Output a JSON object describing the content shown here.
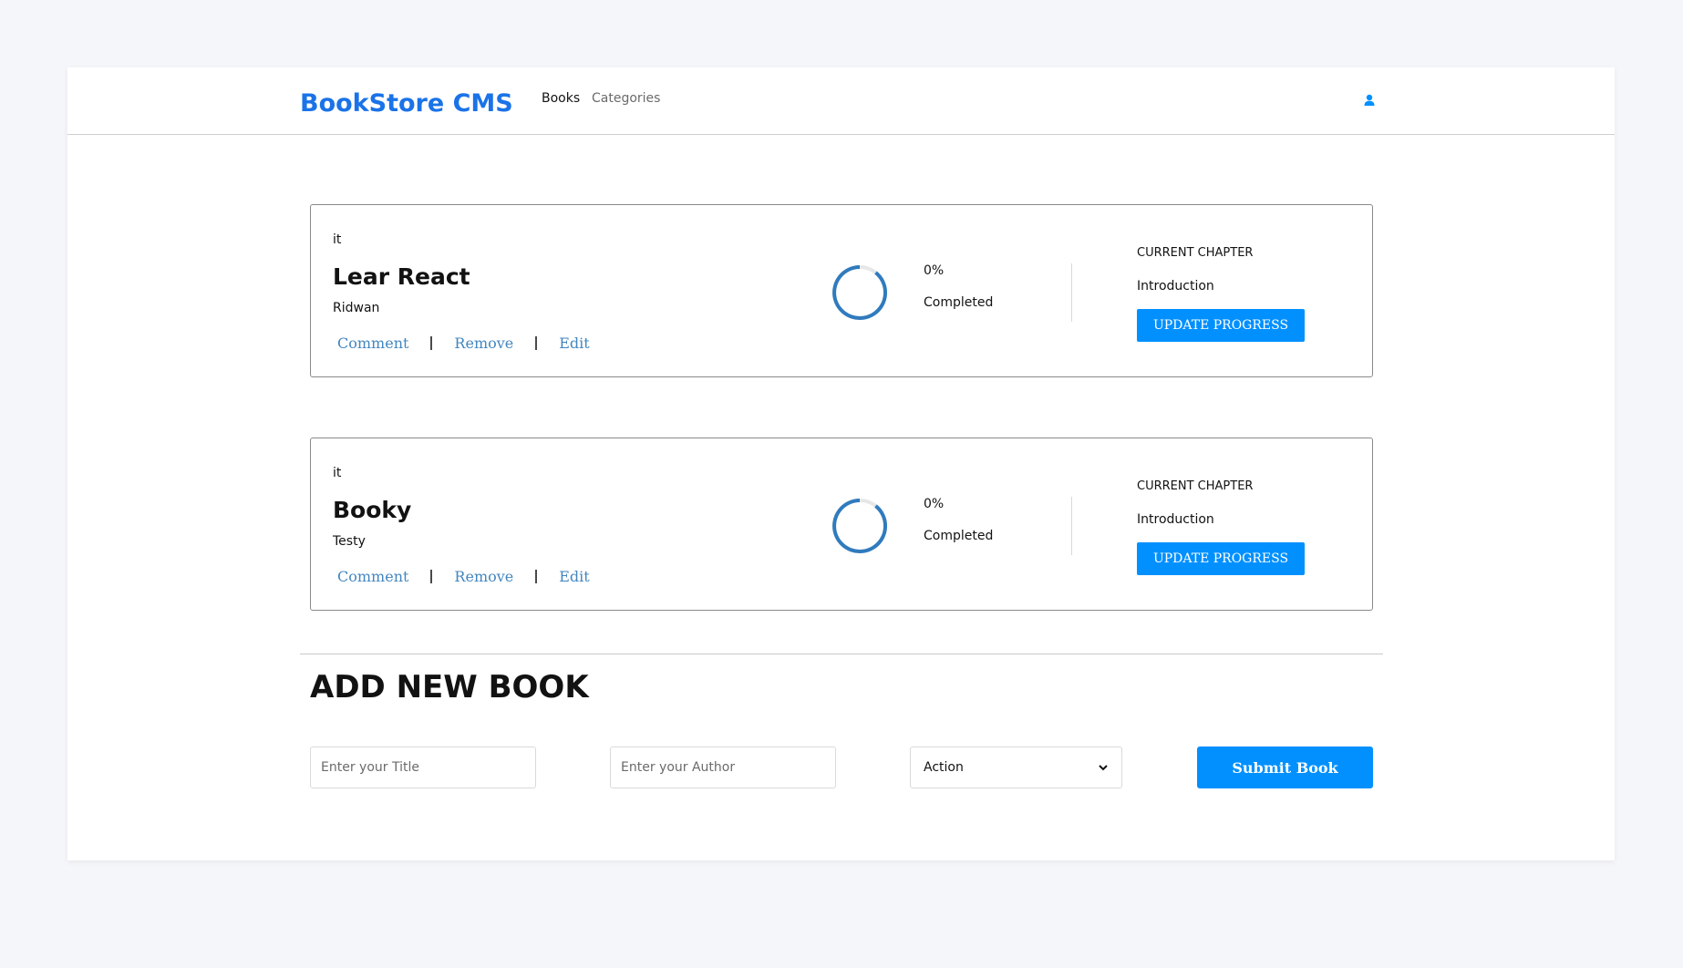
{
  "header": {
    "brand": "BookStore CMS",
    "nav": [
      {
        "label": "Books"
      },
      {
        "label": "Categories"
      }
    ],
    "user_icon": "user-icon"
  },
  "books": [
    {
      "genre": "it",
      "title": "Lear React",
      "author": "Ridwan",
      "actions": {
        "comment": "Comment",
        "remove": "Remove",
        "edit": "Edit"
      },
      "progress": {
        "percent_text": "0%",
        "value": 0,
        "status": "Completed"
      },
      "chapter": {
        "label": "CURRENT CHAPTER",
        "name": "Introduction"
      },
      "update_label": "UPDATE PROGRESS"
    },
    {
      "genre": "it",
      "title": "Booky",
      "author": "Testy",
      "actions": {
        "comment": "Comment",
        "remove": "Remove",
        "edit": "Edit"
      },
      "progress": {
        "percent_text": "0%",
        "value": 0,
        "status": "Completed"
      },
      "chapter": {
        "label": "CURRENT CHAPTER",
        "name": "Introduction"
      },
      "update_label": "UPDATE PROGRESS"
    }
  ],
  "add_book": {
    "heading": "ADD NEW BOOK",
    "title_placeholder": "Enter your Title",
    "author_placeholder": "Enter your Author",
    "category_selected": "Action",
    "submit_label": "Submit Book"
  },
  "colors": {
    "brand": "#1a73e8",
    "accent": "#0290ff",
    "link": "#4386bf",
    "ring": "#307bbe"
  }
}
